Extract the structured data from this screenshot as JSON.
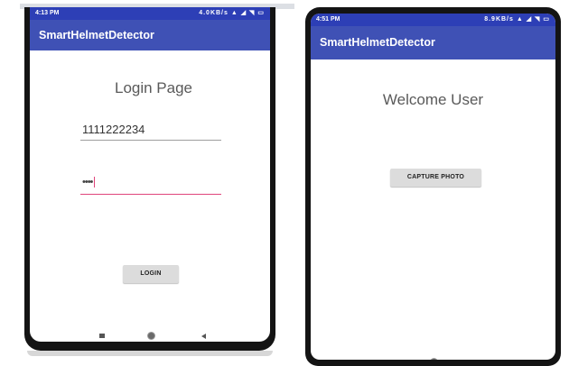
{
  "login_screen": {
    "status_time": "4:13 PM",
    "status_icons": "4.0KB/s ▲ ◢ ◥ ▭",
    "app_title": "SmartHelmetDetector",
    "page_title": "Login Page",
    "phone_value": "1111222234",
    "password_value": "••••",
    "login_button": "LOGIN"
  },
  "welcome_screen": {
    "status_time": "4:51 PM",
    "status_icons": "8.9KB/s ▲ ◢ ◥ ▭",
    "app_title": "SmartHelmetDetector",
    "welcome_text": "Welcome User",
    "capture_button": "CAPTURE PHOTO"
  },
  "navbar_icons": [
    "recent-apps-icon",
    "home-icon",
    "back-icon"
  ],
  "colors": {
    "appbar": "#3f51b5",
    "statusbar": "#2d3fb6",
    "accent": "#e0457b",
    "button": "#dcdcdc"
  }
}
